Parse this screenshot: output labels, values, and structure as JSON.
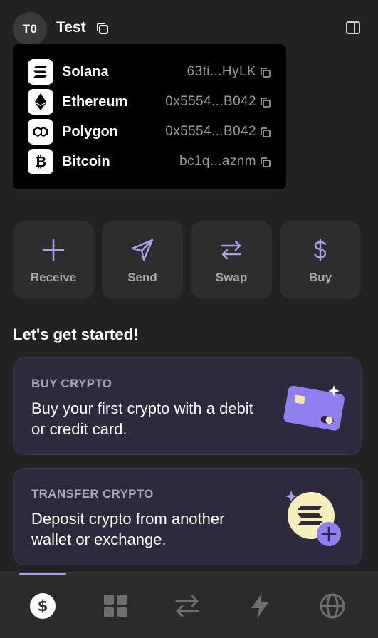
{
  "header": {
    "avatar_initials": "T0",
    "account_name": "Test"
  },
  "networks": [
    {
      "name": "Solana",
      "address": "63ti...HyLK",
      "icon": "solana-icon"
    },
    {
      "name": "Ethereum",
      "address": "0x5554...B042",
      "icon": "ethereum-icon"
    },
    {
      "name": "Polygon",
      "address": "0x5554...B042",
      "icon": "polygon-icon"
    },
    {
      "name": "Bitcoin",
      "address": "bc1q...aznm",
      "icon": "bitcoin-icon"
    }
  ],
  "actions": [
    {
      "label": "Receive",
      "icon": "plus-icon"
    },
    {
      "label": "Send",
      "icon": "send-icon"
    },
    {
      "label": "Swap",
      "icon": "swap-icon"
    },
    {
      "label": "Buy",
      "icon": "dollar-icon"
    }
  ],
  "get_started": {
    "title": "Let's get started!",
    "cards": [
      {
        "kicker": "BUY CRYPTO",
        "body": "Buy your first crypto with a debit or credit card."
      },
      {
        "kicker": "TRANSFER CRYPTO",
        "body": "Deposit crypto from another wallet or exchange."
      }
    ]
  },
  "bottom_nav": [
    "wallet-icon",
    "collectibles-icon",
    "swap-icon",
    "activity-icon",
    "explore-icon"
  ],
  "colors": {
    "accent": "#ab9ff2",
    "background": "#222222",
    "card": "#2e2a3d"
  }
}
